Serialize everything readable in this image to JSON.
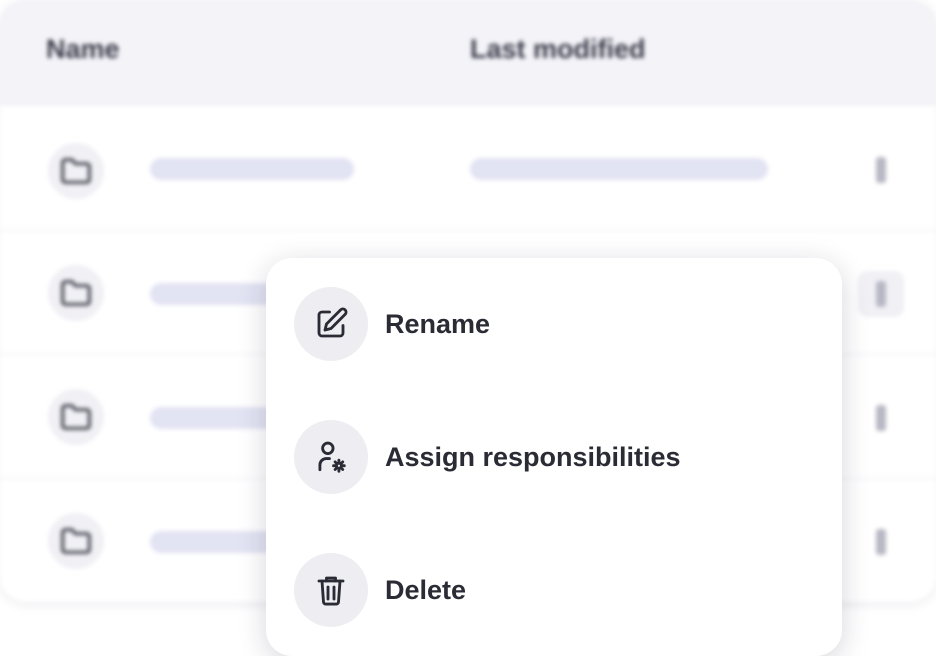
{
  "table": {
    "columns": {
      "name": "Name",
      "last_modified": "Last modified"
    },
    "rows": [
      {
        "icon": "folder-icon"
      },
      {
        "icon": "folder-icon"
      },
      {
        "icon": "folder-icon"
      },
      {
        "icon": "folder-icon"
      }
    ]
  },
  "context_menu": {
    "items": [
      {
        "label": "Rename",
        "icon": "edit-icon"
      },
      {
        "label": "Assign responsibilities",
        "icon": "user-settings-icon"
      },
      {
        "label": "Delete",
        "icon": "trash-icon"
      }
    ]
  },
  "colors": {
    "header_bg": "#f3f3f8",
    "skeleton": "#e2e3f3",
    "menu_icon_bg": "#ededf2",
    "text": "#2b2b36"
  }
}
